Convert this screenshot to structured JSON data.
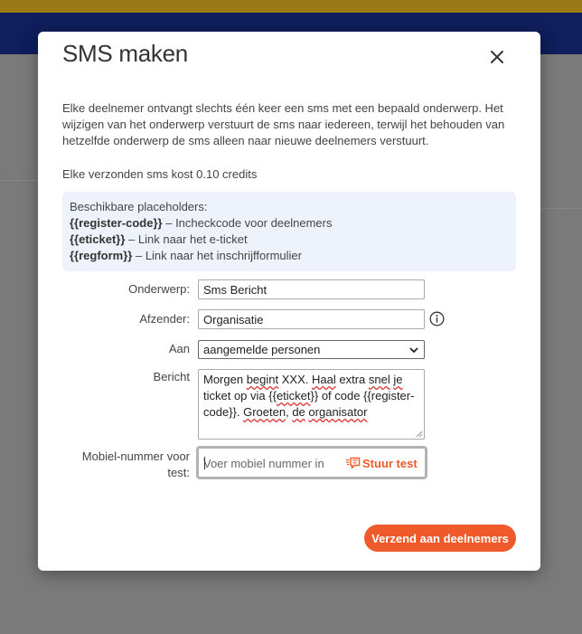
{
  "modal": {
    "title": "SMS maken",
    "intro": "Elke deelnemer ontvangt slechts één keer een sms met een bepaald onderwerp. Het wijzigen van het onderwerp verstuurt de sms naar iedereen, terwijl het behouden van hetzelfde onderwerp de sms alleen naar nieuwe deelnemers verstuurt.",
    "cost": "Elke verzonden sms kost 0.10 credits",
    "placeholders": {
      "heading": "Beschikbare placeholders:",
      "items": [
        {
          "code": "{{register-code}}",
          "desc": " – Incheckcode voor deelnemers"
        },
        {
          "code": "{{eticket}}",
          "desc": " – Link naar het e-ticket"
        },
        {
          "code": "{{regform}}",
          "desc": " – Link naar het inschrijfformulier"
        }
      ]
    }
  },
  "form": {
    "subject_label": "Onderwerp:",
    "subject_value": "Sms Bericht",
    "sender_label": "Afzender:",
    "sender_value": "Organisatie",
    "to_label": "Aan",
    "to_value": "aangemelde personen",
    "message_label": "Bericht",
    "message_parts": [
      "Morgen ",
      "begint",
      " XXX. ",
      "Haal",
      " extra ",
      "snel",
      " ",
      "je",
      " ticket op via {{",
      "eticket",
      "}} of code {{register-code}}. ",
      "Groeten",
      ", ",
      "de",
      " ",
      "organisator"
    ],
    "test_label_line1": "Mobiel-nummer voor",
    "test_label_line2": "test:",
    "test_placeholder": "Voer mobiel nummer in",
    "send_test_label": "Stuur test",
    "send_label": "Verzend aan deelnemers"
  },
  "colors": {
    "accent": "#ef5a2b",
    "placeholder_bg": "#eef3fb",
    "nav": "#0f1e5c"
  },
  "icons": [
    "close-icon",
    "info-icon",
    "sms-send-icon",
    "chevron-down-icon"
  ]
}
